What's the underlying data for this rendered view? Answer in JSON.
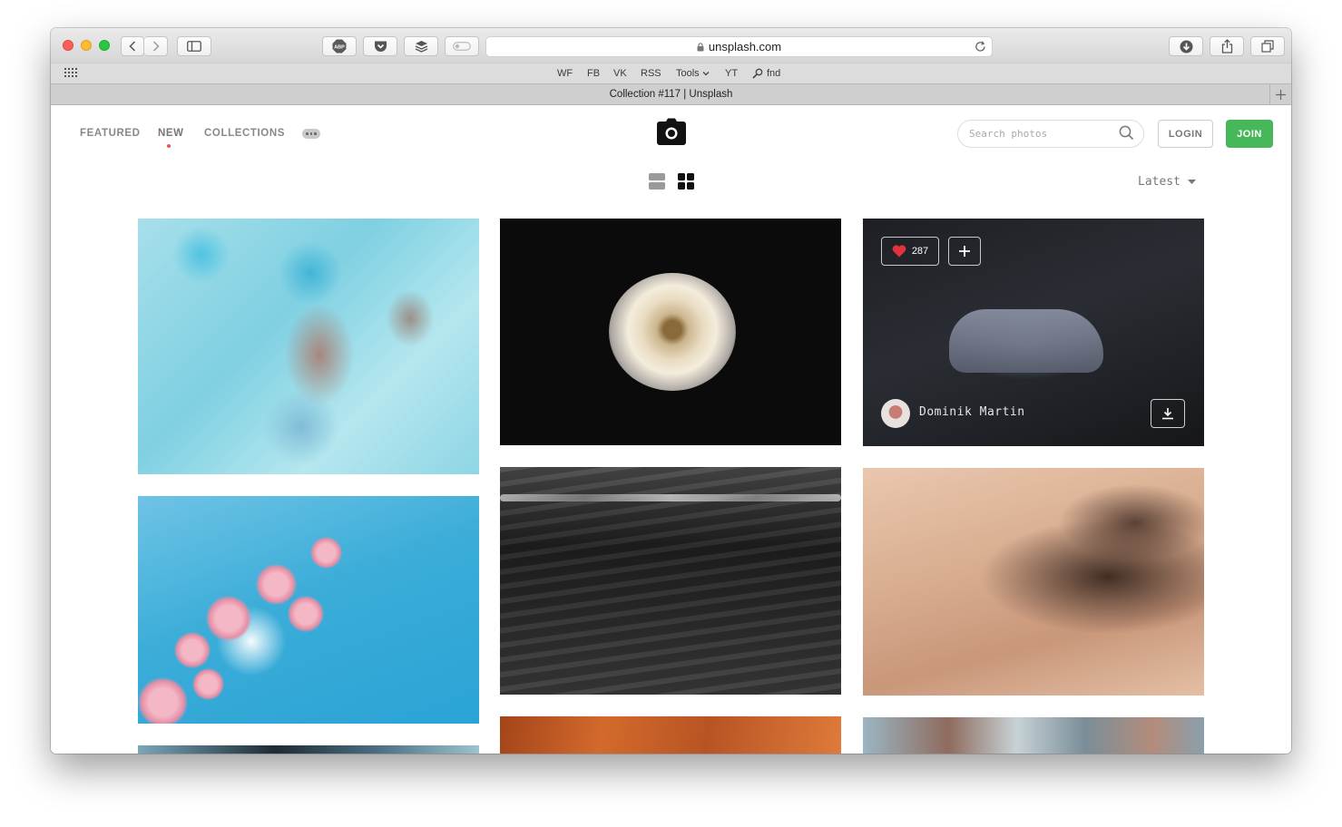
{
  "browser": {
    "url": "unsplash.com",
    "tab_title": "Collection #117 | Unsplash",
    "favorites": [
      "WF",
      "FB",
      "VK",
      "RSS",
      "Tools",
      "YT",
      "fnd"
    ],
    "toolbar_icons": [
      "back-icon",
      "forward-icon",
      "sidebar-icon",
      "adblock-icon",
      "pocket-icon",
      "buffer-icon",
      "extension-icon",
      "lock-icon",
      "reload-icon",
      "download-icon",
      "share-icon",
      "tabs-icon"
    ]
  },
  "nav": {
    "featured": "FEATURED",
    "new": "NEW",
    "collections": "COLLECTIONS"
  },
  "header": {
    "search_placeholder": "Search photos",
    "login": "LOGIN",
    "join": "JOIN",
    "accent_color": "#46b85a"
  },
  "view": {
    "sort_label": "Latest"
  },
  "photos": {
    "hovered": {
      "likes": "287",
      "author": "Dominik Martin"
    }
  }
}
